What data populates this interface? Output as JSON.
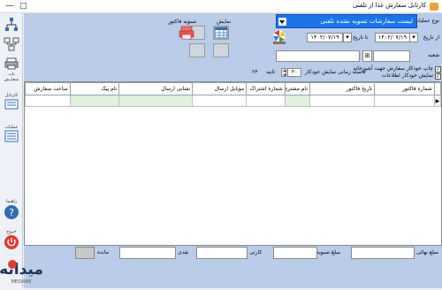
{
  "window": {
    "title": "کارتابل سفارش غذا از تلفنی",
    "minimize": "—",
    "maximize": "□"
  },
  "sidebar": {
    "items": [
      {
        "label": "",
        "icon": "tree-network-icon"
      },
      {
        "label": "",
        "icon": "network-icon"
      },
      {
        "label": "تاب سفارش",
        "icon": "print-icon"
      },
      {
        "label": "کارتابل",
        "icon": "cartable-icon"
      },
      {
        "label": "عملیات",
        "icon": "operations-icon"
      },
      {
        "label": "راهنما",
        "icon": "help-icon"
      },
      {
        "label": "خروج",
        "icon": "power-icon"
      }
    ]
  },
  "filters": {
    "operation_type_label": "نوع عملیات",
    "operation_type_value": "لیست سفارشات تسویه نشده تلفنی",
    "from_date_label": "از تاریخ",
    "from_date": "۱۴۰۲/۰۷/۱۹",
    "to_date_label": "تا تاریخ",
    "to_date": "۱۴۰۲/۰۷/۱۹",
    "branch_label": "شعبه",
    "auto_print_label": "چاپ خودکار سفارش جهت آشپزخانه",
    "auto_show_label": "نمایش خودکار اطلاعات",
    "auto_print_checked": true,
    "auto_show_checked": true,
    "interval_label": "فاصله زمانی نمایش خودکار",
    "interval_value": "۳۰",
    "seconds_label": "ثانیه",
    "count_value": "۲۳"
  },
  "toolbar": {
    "show_label": "نمایش",
    "invoice_label": "تسویه فاکتور"
  },
  "table": {
    "columns": [
      "شماره فاکتور",
      "تاریخ فاکتور",
      "نام مشتری",
      "شماره اشتراک",
      "موبایل ارسال",
      "نشانی ارسال",
      "نام پیک",
      "ساعت سفارش"
    ],
    "row_indicator": "▶"
  },
  "footer": {
    "final_amount_label": "مبلغ نهائی",
    "settlement_amount_label": "مبلغ تسویه",
    "card_label": "کارتی",
    "cash_label": "نقدی",
    "remaining_label": "مانده",
    "final_amount": "",
    "settlement_amount": "",
    "card_amount": "",
    "cash_amount": "",
    "remaining_amount": ""
  },
  "watermark": {
    "brand": "میهانه",
    "sub": "MEIDANE"
  },
  "colors": {
    "accent": "#1a73e8",
    "panel": "#b9cdea",
    "power": "#e53935",
    "green_cell": "#dff3dc"
  }
}
